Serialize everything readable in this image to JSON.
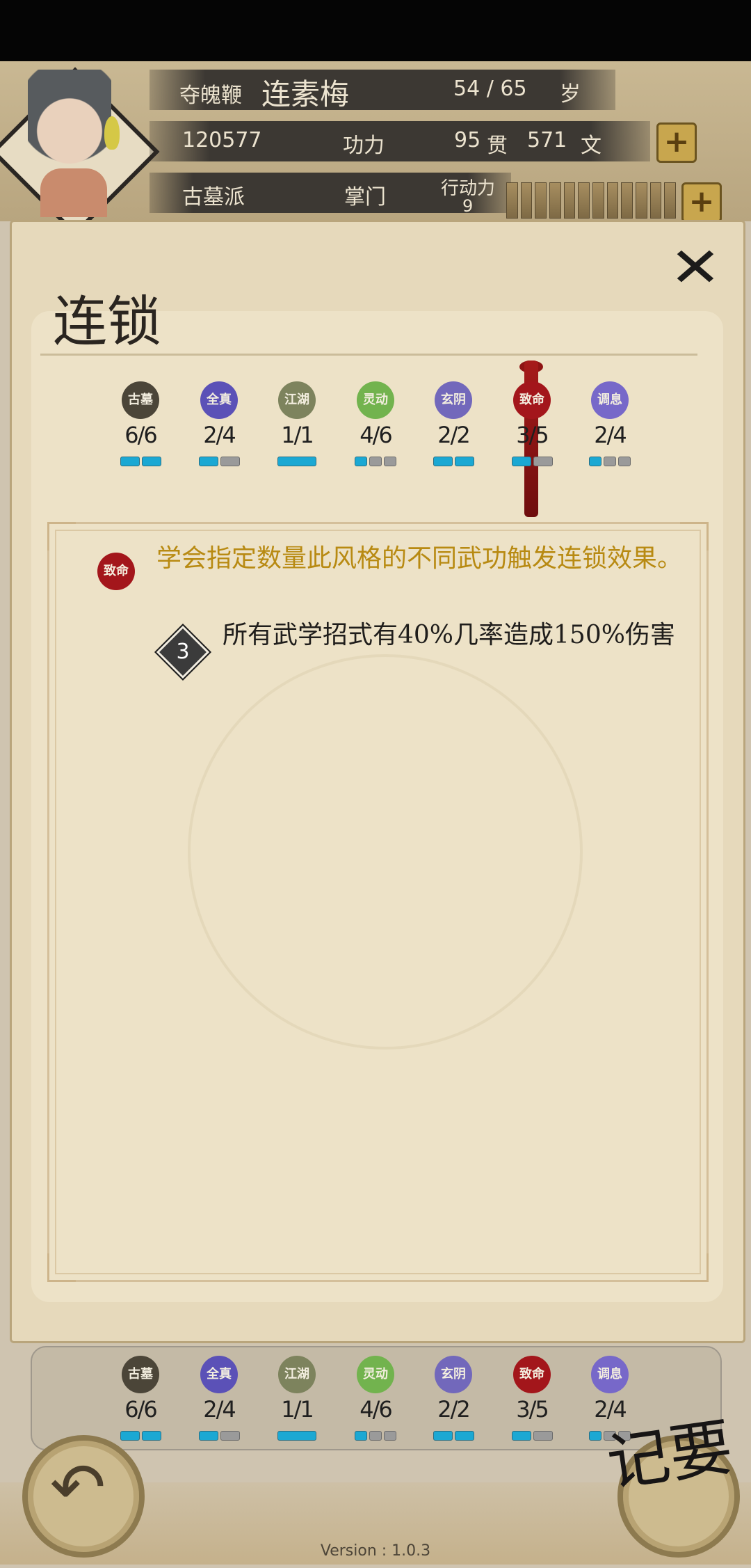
{
  "header": {
    "title_name": "夺魄鞭",
    "character_name": "连素梅",
    "age": "54 / 65",
    "age_unit": "岁",
    "power_value": "120577",
    "power_label": "功力",
    "money_guan": "95",
    "money_guan_unit": "贯",
    "money_wen": "571",
    "money_wen_unit": "文",
    "sect": "古墓派",
    "rank": "掌门",
    "action_label": "行动力",
    "action_value": "9",
    "action_fill": 0.0
  },
  "modal": {
    "title": "连锁",
    "close_icon": "close-x"
  },
  "styles": [
    {
      "badge": "古墓",
      "count": "6/6",
      "filled": 2,
      "total": 2,
      "color": "#4b4538"
    },
    {
      "badge": "全真",
      "count": "2/4",
      "filled": 1,
      "total": 2,
      "color": "#5b51b7"
    },
    {
      "badge": "江湖",
      "count": "1/1",
      "filled": 1,
      "total": 1,
      "color": "#7d835d"
    },
    {
      "badge": "灵动",
      "count": "4/6",
      "filled": 1,
      "total": 3,
      "color": "#72b34e"
    },
    {
      "badge": "玄阴",
      "count": "2/2",
      "filled": 2,
      "total": 2,
      "color": "#7268bb"
    },
    {
      "badge": "致命",
      "count": "3/5",
      "filled": 1,
      "total": 2,
      "color": "#a3161b"
    },
    {
      "badge": "调息",
      "count": "2/4",
      "filled": 1,
      "total": 3,
      "color": "#7768c9"
    }
  ],
  "selected_style": {
    "badge": "致命",
    "description": "学会指定数量此风格的不同武功触发连锁效果。",
    "tier": "3",
    "effect": "所有武学招式有40%几率造成150%伤害"
  },
  "footer": {
    "jiyao_label": "记要",
    "version": "Version : 1.0.3"
  },
  "colors": {
    "accent_text": "#b88a12",
    "pip_on": "#1ba8d3",
    "pip_off": "#9a9a9a"
  }
}
